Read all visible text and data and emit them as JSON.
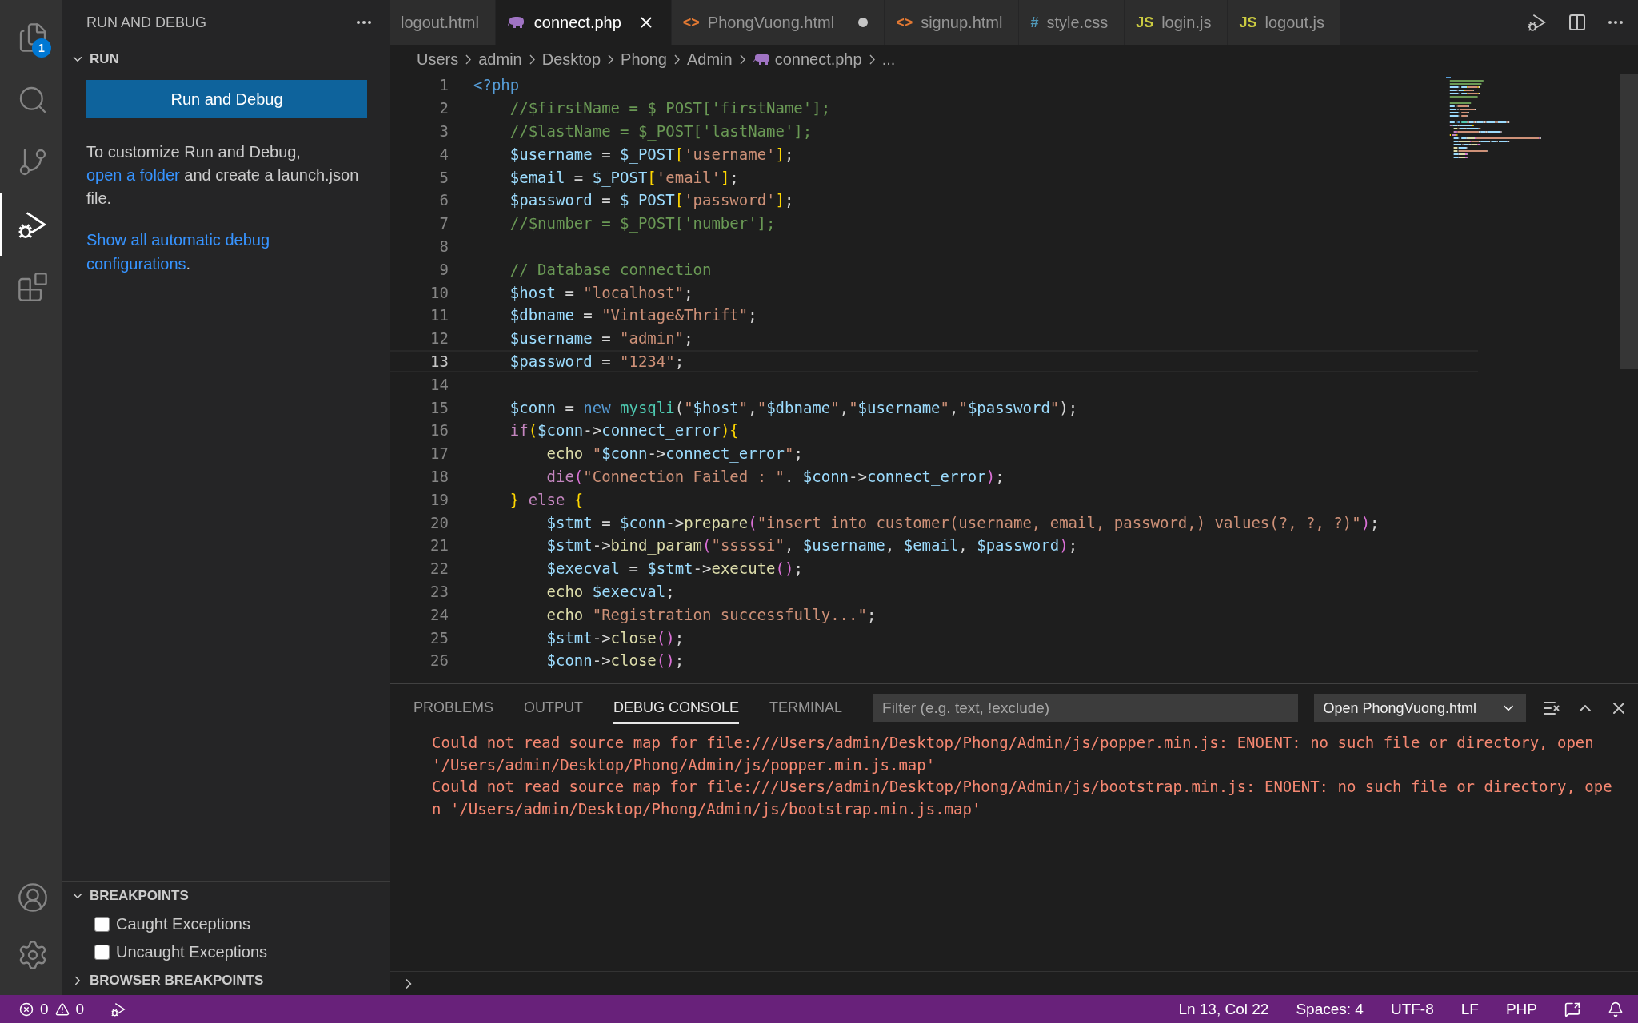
{
  "activity_bar": {
    "items": [
      {
        "kind": "files",
        "selected": false,
        "badge": "1"
      },
      {
        "kind": "search",
        "selected": false
      },
      {
        "kind": "source_control",
        "selected": false
      },
      {
        "kind": "run_debug",
        "selected": true
      },
      {
        "kind": "extensions",
        "selected": false
      }
    ],
    "bottom": [
      {
        "kind": "account"
      },
      {
        "kind": "settings"
      }
    ]
  },
  "sidebar": {
    "title": "RUN AND DEBUG",
    "run_section": {
      "title": "RUN",
      "expanded": true,
      "button": "Run and Debug",
      "help": {
        "before": "To customize Run and Debug, ",
        "link": "open a folder",
        "after": " and create a launch.json file."
      },
      "link": "Show all automatic debug configurations",
      "link_suffix": "."
    },
    "breakpoints": {
      "title": "BREAKPOINTS",
      "expanded": true,
      "items": [
        {
          "label": "Caught Exceptions",
          "checked": false
        },
        {
          "label": "Uncaught Exceptions",
          "checked": false
        }
      ]
    },
    "browser_breakpoints": {
      "title": "BROWSER BREAKPOINTS",
      "expanded": false
    }
  },
  "tabs": [
    {
      "label": "logout.html",
      "kind": "plain",
      "selected": false,
      "dirty": false
    },
    {
      "label": "connect.php",
      "kind": "php",
      "selected": true,
      "dirty": false
    },
    {
      "label": "PhongVuong.html",
      "kind": "html",
      "glyph": "<>",
      "selected": false,
      "dirty": true
    },
    {
      "label": "signup.html",
      "kind": "html",
      "glyph": "<>",
      "selected": false,
      "dirty": false
    },
    {
      "label": "style.css",
      "kind": "css",
      "glyph": "#",
      "selected": false,
      "dirty": false
    },
    {
      "label": "login.js",
      "kind": "js",
      "glyph": "JS",
      "selected": false,
      "dirty": false
    },
    {
      "label": "logout.js",
      "kind": "js",
      "glyph": "JS",
      "selected": false,
      "dirty": false
    }
  ],
  "breadcrumb": {
    "segments": [
      "Users",
      "admin",
      "Desktop",
      "Phong",
      "Admin"
    ],
    "file": "connect.php",
    "tail": "..."
  },
  "editor": {
    "lines": [
      {
        "number": "1",
        "current": false,
        "tokens": [
          {
            "kind": "tag",
            "text": "<?php"
          }
        ]
      },
      {
        "number": "2",
        "current": false,
        "tokens": [
          {
            "kind": "comment",
            "text": "    //$firstName = $_POST['firstName'];"
          }
        ]
      },
      {
        "number": "3",
        "current": false,
        "tokens": [
          {
            "kind": "comment",
            "text": "    //$lastName = $_POST['lastName'];"
          }
        ]
      },
      {
        "number": "4",
        "current": false,
        "tokens": [
          {
            "kind": "var",
            "text": "    $username"
          },
          {
            "kind": "op",
            "text": " = "
          },
          {
            "kind": "var",
            "text": "$_POST"
          },
          {
            "kind": "bracket",
            "text": "["
          },
          {
            "kind": "str",
            "text": "'username'"
          },
          {
            "kind": "bracket",
            "text": "]"
          },
          {
            "kind": "op",
            "text": ";"
          }
        ]
      },
      {
        "number": "5",
        "current": false,
        "tokens": [
          {
            "kind": "var",
            "text": "    $email"
          },
          {
            "kind": "op",
            "text": " = "
          },
          {
            "kind": "var",
            "text": "$_POST"
          },
          {
            "kind": "bracket",
            "text": "["
          },
          {
            "kind": "str",
            "text": "'email'"
          },
          {
            "kind": "bracket",
            "text": "]"
          },
          {
            "kind": "op",
            "text": ";"
          }
        ]
      },
      {
        "number": "6",
        "current": false,
        "tokens": [
          {
            "kind": "var",
            "text": "    $password"
          },
          {
            "kind": "op",
            "text": " = "
          },
          {
            "kind": "var",
            "text": "$_POST"
          },
          {
            "kind": "bracket",
            "text": "["
          },
          {
            "kind": "str",
            "text": "'password'"
          },
          {
            "kind": "bracket",
            "text": "]"
          },
          {
            "kind": "op",
            "text": ";"
          }
        ]
      },
      {
        "number": "7",
        "current": false,
        "tokens": [
          {
            "kind": "comment",
            "text": "    //$number = $_POST['number'];"
          }
        ]
      },
      {
        "number": "8",
        "current": false
      },
      {
        "number": "9",
        "current": false,
        "tokens": [
          {
            "kind": "comment",
            "text": "    // Database connection"
          }
        ]
      },
      {
        "number": "10",
        "current": false,
        "tokens": [
          {
            "kind": "var",
            "text": "    $host"
          },
          {
            "kind": "op",
            "text": " = "
          },
          {
            "kind": "str",
            "text": "\"localhost\""
          },
          {
            "kind": "op",
            "text": ";"
          }
        ]
      },
      {
        "number": "11",
        "current": false,
        "tokens": [
          {
            "kind": "var",
            "text": "    $dbname"
          },
          {
            "kind": "op",
            "text": " = "
          },
          {
            "kind": "str",
            "text": "\"Vintage&Thrift\""
          },
          {
            "kind": "op",
            "text": ";"
          }
        ]
      },
      {
        "number": "12",
        "current": false,
        "tokens": [
          {
            "kind": "var",
            "text": "    $username"
          },
          {
            "kind": "op",
            "text": " = "
          },
          {
            "kind": "str",
            "text": "\"admin\""
          },
          {
            "kind": "op",
            "text": ";"
          }
        ]
      },
      {
        "number": "13",
        "current": true,
        "tokens": [
          {
            "kind": "var",
            "text": "    $password"
          },
          {
            "kind": "op",
            "text": " = "
          },
          {
            "kind": "str",
            "text": "\"1234\""
          },
          {
            "kind": "op",
            "text": ";"
          }
        ]
      },
      {
        "number": "14",
        "current": false
      },
      {
        "number": "15",
        "current": false,
        "tokens": [
          {
            "kind": "var",
            "text": "    $conn"
          },
          {
            "kind": "op",
            "text": " = "
          },
          {
            "kind": "keyword",
            "text": "new "
          },
          {
            "kind": "class",
            "text": "mysqli"
          },
          {
            "kind": "op",
            "text": "("
          },
          {
            "kind": "str",
            "text": "\""
          },
          {
            "kind": "var",
            "text": "$host"
          },
          {
            "kind": "str",
            "text": "\""
          },
          {
            "kind": "op",
            "text": ","
          },
          {
            "kind": "str",
            "text": "\""
          },
          {
            "kind": "var",
            "text": "$dbname"
          },
          {
            "kind": "str",
            "text": "\""
          },
          {
            "kind": "op",
            "text": ","
          },
          {
            "kind": "str",
            "text": "\""
          },
          {
            "kind": "var",
            "text": "$username"
          },
          {
            "kind": "str",
            "text": "\""
          },
          {
            "kind": "op",
            "text": ","
          },
          {
            "kind": "str",
            "text": "\""
          },
          {
            "kind": "var",
            "text": "$password"
          },
          {
            "kind": "str",
            "text": "\""
          },
          {
            "kind": "op",
            "text": ");"
          }
        ]
      },
      {
        "number": "16",
        "current": false,
        "tokens": [
          {
            "kind": "control",
            "text": "    if"
          },
          {
            "kind": "bracket",
            "text": "("
          },
          {
            "kind": "var",
            "text": "$conn"
          },
          {
            "kind": "op",
            "text": "->"
          },
          {
            "kind": "var",
            "text": "connect_error"
          },
          {
            "kind": "bracket",
            "text": "){"
          }
        ]
      },
      {
        "number": "17",
        "current": false,
        "tokens": [
          {
            "kind": "func",
            "text": "        echo "
          },
          {
            "kind": "str",
            "text": "\""
          },
          {
            "kind": "var",
            "text": "$conn"
          },
          {
            "kind": "op",
            "text": "->"
          },
          {
            "kind": "var",
            "text": "connect_error"
          },
          {
            "kind": "str",
            "text": "\""
          },
          {
            "kind": "op",
            "text": ";"
          }
        ]
      },
      {
        "number": "18",
        "current": false,
        "tokens": [
          {
            "kind": "control",
            "text": "        die"
          },
          {
            "kind": "paren",
            "text": "("
          },
          {
            "kind": "str",
            "text": "\"Connection Failed : \""
          },
          {
            "kind": "op",
            "text": ". "
          },
          {
            "kind": "var",
            "text": "$conn"
          },
          {
            "kind": "op",
            "text": "->"
          },
          {
            "kind": "var",
            "text": "connect_error"
          },
          {
            "kind": "paren",
            "text": ")"
          },
          {
            "kind": "op",
            "text": ";"
          }
        ]
      },
      {
        "number": "19",
        "current": false,
        "tokens": [
          {
            "kind": "bracket",
            "text": "    }"
          },
          {
            "kind": "control",
            "text": " else "
          },
          {
            "kind": "bracket",
            "text": "{"
          }
        ]
      },
      {
        "number": "20",
        "current": false,
        "tokens": [
          {
            "kind": "var",
            "text": "        $stmt"
          },
          {
            "kind": "op",
            "text": " = "
          },
          {
            "kind": "var",
            "text": "$conn"
          },
          {
            "kind": "op",
            "text": "->"
          },
          {
            "kind": "func",
            "text": "prepare"
          },
          {
            "kind": "paren",
            "text": "("
          },
          {
            "kind": "str",
            "text": "\"insert into customer(username, email, password,) values(?, ?, ?)\""
          },
          {
            "kind": "paren",
            "text": ")"
          },
          {
            "kind": "op",
            "text": ";"
          }
        ]
      },
      {
        "number": "21",
        "current": false,
        "tokens": [
          {
            "kind": "var",
            "text": "        $stmt"
          },
          {
            "kind": "op",
            "text": "->"
          },
          {
            "kind": "func",
            "text": "bind_param"
          },
          {
            "kind": "paren",
            "text": "("
          },
          {
            "kind": "str",
            "text": "\"sssssi\""
          },
          {
            "kind": "op",
            "text": ", "
          },
          {
            "kind": "var",
            "text": "$username"
          },
          {
            "kind": "op",
            "text": ", "
          },
          {
            "kind": "var",
            "text": "$email"
          },
          {
            "kind": "op",
            "text": ", "
          },
          {
            "kind": "var",
            "text": "$password"
          },
          {
            "kind": "paren",
            "text": ")"
          },
          {
            "kind": "op",
            "text": ";"
          }
        ]
      },
      {
        "number": "22",
        "current": false,
        "tokens": [
          {
            "kind": "var",
            "text": "        $execval"
          },
          {
            "kind": "op",
            "text": " = "
          },
          {
            "kind": "var",
            "text": "$stmt"
          },
          {
            "kind": "op",
            "text": "->"
          },
          {
            "kind": "func",
            "text": "execute"
          },
          {
            "kind": "paren",
            "text": "()"
          },
          {
            "kind": "op",
            "text": ";"
          }
        ]
      },
      {
        "number": "23",
        "current": false,
        "tokens": [
          {
            "kind": "func",
            "text": "        echo "
          },
          {
            "kind": "var",
            "text": "$execval"
          },
          {
            "kind": "op",
            "text": ";"
          }
        ]
      },
      {
        "number": "24",
        "current": false,
        "tokens": [
          {
            "kind": "func",
            "text": "        echo "
          },
          {
            "kind": "str",
            "text": "\"Registration successfully...\""
          },
          {
            "kind": "op",
            "text": ";"
          }
        ]
      },
      {
        "number": "25",
        "current": false,
        "tokens": [
          {
            "kind": "var",
            "text": "        $stmt"
          },
          {
            "kind": "op",
            "text": "->"
          },
          {
            "kind": "func",
            "text": "close"
          },
          {
            "kind": "paren",
            "text": "()"
          },
          {
            "kind": "op",
            "text": ";"
          }
        ]
      },
      {
        "number": "26",
        "current": false,
        "tokens": [
          {
            "kind": "var",
            "text": "        $conn"
          },
          {
            "kind": "op",
            "text": "->"
          },
          {
            "kind": "func",
            "text": "close"
          },
          {
            "kind": "paren",
            "text": "()"
          },
          {
            "kind": "op",
            "text": ";"
          }
        ]
      }
    ]
  },
  "panel": {
    "tabs": [
      {
        "label": "PROBLEMS",
        "selected": false
      },
      {
        "label": "OUTPUT",
        "selected": false
      },
      {
        "label": "DEBUG CONSOLE",
        "selected": true
      },
      {
        "label": "TERMINAL",
        "selected": false
      }
    ],
    "filter": {
      "placeholder": "Filter (e.g. text, !exclude)"
    },
    "launch_select": "Open PhongVuong.html",
    "messages": [
      "Could not read source map for file:///Users/admin/Desktop/Phong/Admin/js/popper.min.js: ENOENT: no such file or directory, open '/Users/admin/Desktop/Phong/Admin/js/popper.min.js.map'",
      "Could not read source map for file:///Users/admin/Desktop/Phong/Admin/js/bootstrap.min.js: ENOENT: no such file or directory, open '/Users/admin/Desktop/Phong/Admin/js/bootstrap.min.js.map'"
    ]
  },
  "status_bar": {
    "errors": "0",
    "warnings": "0",
    "items": [
      "Ln 13, Col 22",
      "Spaces: 4",
      "UTF-8",
      "LF",
      "PHP"
    ]
  }
}
